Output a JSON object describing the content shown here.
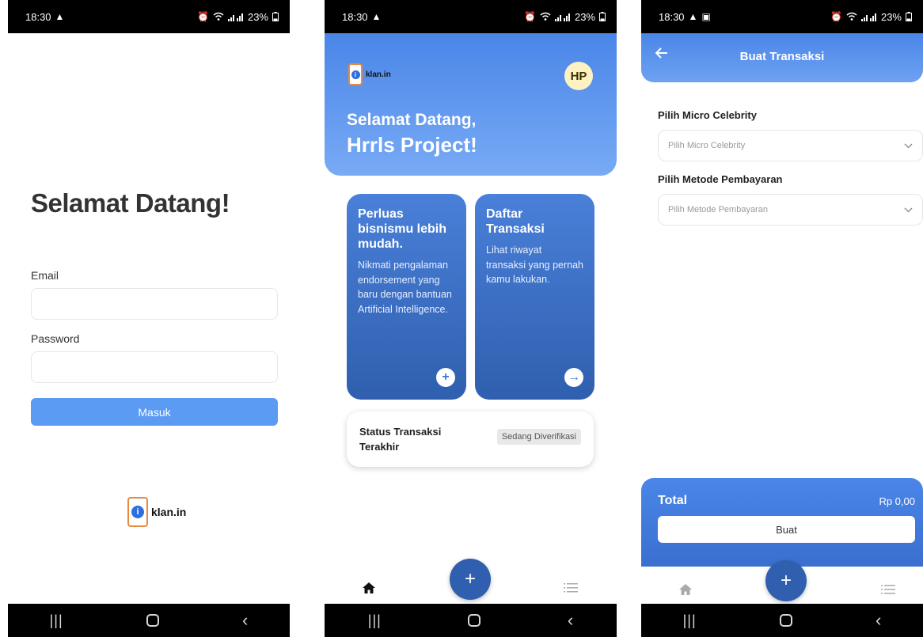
{
  "status_bar": {
    "time": "18:30",
    "battery": "23%"
  },
  "login": {
    "title": "Selamat Datang!",
    "email_label": "Email",
    "password_label": "Password",
    "submit_label": "Masuk",
    "logo_glyph": "i",
    "logo_text": "klan.in"
  },
  "home": {
    "logo_glyph": "i",
    "logo_text": "klan.in",
    "avatar_initials": "HP",
    "greeting_line1": "Selamat Datang,",
    "greeting_line2": "Hrrls Project!",
    "cards": [
      {
        "title": "Perluas bisnismu lebih mudah.",
        "description": "Nikmati pengalaman endorsement yang baru dengan bantuan Artificial Intelligence.",
        "action_icon": "+"
      },
      {
        "title": "Daftar Transaksi",
        "description": "Lihat riwayat transaksi yang pernah kamu lakukan.",
        "action_icon": "→"
      }
    ],
    "status": {
      "title": "Status Transaksi Terakhir",
      "badge": "Sedang Diverifikasi"
    },
    "fab_icon": "+"
  },
  "transaction": {
    "title": "Buat Transaksi",
    "celebrity_label": "Pilih Micro Celebrity",
    "celebrity_placeholder": "Pilih Micro Celebrity",
    "payment_label": "Pilih Metode Pembayaran",
    "payment_placeholder": "Pilih Metode Pembayaran",
    "total_label": "Total",
    "total_value": "Rp 0,00",
    "submit_label": "Buat",
    "fab_icon": "+"
  },
  "colors": {
    "primary": "#4a86e8",
    "primary_dark": "#2f5fae",
    "button_blue": "#5b9bf3",
    "logo_orange": "#e88a3c",
    "avatar_bg": "#fff2c2"
  },
  "icons": [
    "alert-triangle-icon",
    "alarm-icon",
    "wifi-icon",
    "signal-icon",
    "battery-icon",
    "home-icon",
    "list-icon",
    "plus-icon",
    "arrow-right-icon",
    "arrow-left-icon",
    "chevron-down-icon",
    "recent-apps-icon",
    "back-icon",
    "image-icon"
  ]
}
